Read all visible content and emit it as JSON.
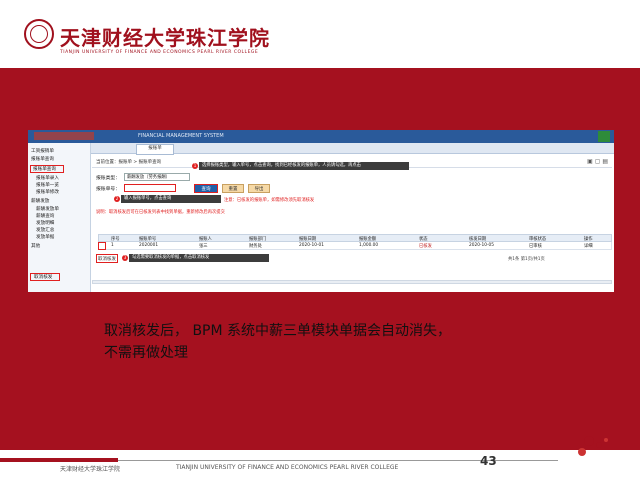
{
  "header": {
    "school_name_cn": "天津财经大学珠江学院",
    "school_name_en": "TIANJIN UNIVERSITY OF FINANCE AND ECONOMICS PEARL RIVER COLLEGE"
  },
  "screenshot": {
    "app_title": "FINANCIAL MANAGEMENT SYSTEM",
    "active_tab": "报账单",
    "breadcrumb": "当前位置：报账单 > 报账单查询",
    "sidebar": {
      "items": [
        "工资报销单",
        "报账单查询",
        "报账单录入",
        "报账单一览",
        "报账单修改",
        "薪酬发放",
        "薪酬发放单",
        "薪酬查询",
        "发放明细",
        "发放汇总",
        "发放单据",
        "其他"
      ],
      "highlight_item": "报账单查询",
      "highlight_item_2": "取消核发"
    },
    "form": {
      "type_label": "报账类型：",
      "type_value": "薪酬发放（劳务报酬）",
      "number_label": "报账单号：",
      "number_value": "",
      "query_button": "查询",
      "button_2": "重置",
      "button_3": "导出"
    },
    "callouts": {
      "c1": "选择报账类型，输入单号，点击查询，找到已经核发的报账单，人员请勾选，再点击",
      "c2": "输入报账单号，点击查询",
      "c3": "勾选需要取消核发的单据，点击取消核发"
    },
    "notes": {
      "n1": "注意：已核发的报账单，如需修改须先取消核发",
      "n2": "说明：取消核发后可在已核发列表中找到单据，重新修改后再次提交"
    },
    "grid": {
      "headers": [
        "序号",
        "报账单号",
        "报账人",
        "报账部门",
        "报账日期",
        "报账金额",
        "状态",
        "核发日期",
        "审核状态",
        "操作"
      ],
      "row": [
        "1",
        "2020001",
        "张三",
        "财务处",
        "2020-10-01",
        "1,000.00",
        "已核发",
        "2020-10-05",
        "已审核",
        "详细"
      ]
    },
    "cancel_button": "取消核发",
    "pager": "共1条  第1页/共1页"
  },
  "caption": {
    "line1": "取消核发后， BPM 系统中薪三单模块单据会自动消失，",
    "line2": "不需再做处理"
  },
  "footer": {
    "school_cn": "天津财经大学珠江学院",
    "school_en": "TIANJIN UNIVERSITY OF FINANCE AND ECONOMICS PEARL RIVER COLLEGE",
    "page_number": "43"
  },
  "colors": {
    "brand_red": "#a5111f",
    "app_blue": "#2a5a9a",
    "highlight_red": "#e02020"
  }
}
